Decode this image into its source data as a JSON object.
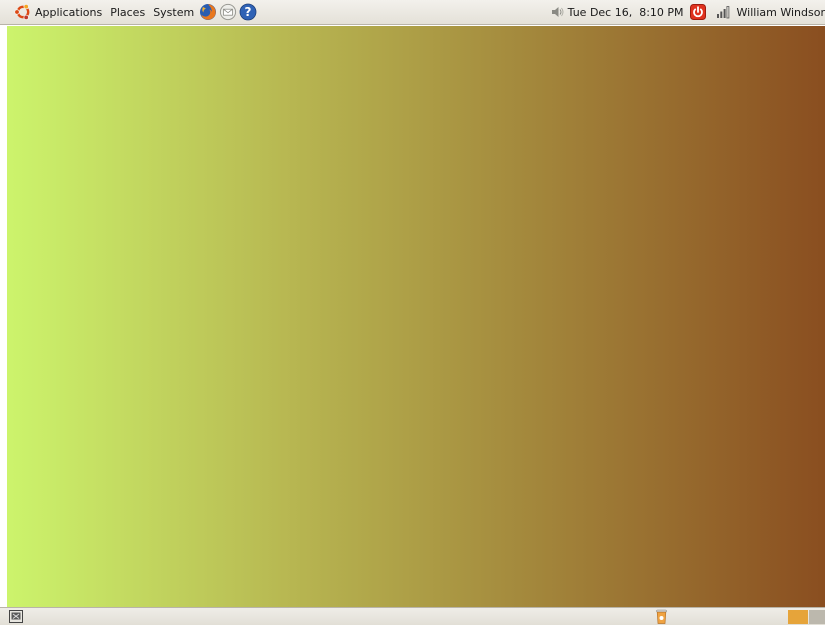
{
  "top_panel": {
    "menus": {
      "applications": "Applications",
      "places": "Places",
      "system": "System"
    },
    "launchers": [
      "firefox-icon",
      "mail-icon",
      "help-icon"
    ],
    "tray": {
      "clock": "Tue Dec 16,  8:10 PM",
      "user": "William Windsor"
    }
  },
  "bottom_panel": {
    "workspaces": 2,
    "active_workspace": 1
  },
  "colors": {
    "panel_bg": "#e8e5de",
    "desktop_left": "#ccf46c",
    "desktop_right": "#8a4e20",
    "workspace_active": "#e6a43a",
    "workspace_inactive": "#bcb8ad"
  }
}
